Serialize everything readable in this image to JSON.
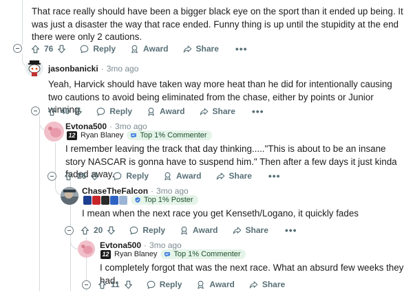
{
  "comments": [
    {
      "body": "That race really should have been a bigger black eye on the sport than it ended up being. It was just a disaster the way that race ended. Funny thing is up until the stupidity at the end there were only 2 cautions.",
      "votes": "76",
      "reply": "Reply",
      "award": "Award",
      "share": "Share",
      "more": "•••"
    },
    {
      "author": "jasonbanicki",
      "age": "3mo ago",
      "body": "Yeah, Harvick should have taken way more heat than he did for intentionally causing two cautions to avoid being eliminated from the chase, either by points or Junior winning.",
      "votes": "40",
      "reply": "Reply",
      "award": "Award",
      "share": "Share",
      "more": "•••"
    },
    {
      "author": "Evtona500",
      "age": "3mo ago",
      "flair_num": "12",
      "flair_text": "Ryan Blaney",
      "badge": "Top 1% Commenter",
      "body": "I remember leaving the track that day thinking.....\"This is about to be an insane story NASCAR is gonna have to suspend him.\" Then after a few days it just kinda faded away.",
      "votes": "26",
      "reply": "Reply",
      "award": "Award",
      "share": "Share",
      "more": "•••"
    },
    {
      "author": "ChaseTheFalcon",
      "age": "3mo ago",
      "badge": "Top 1% Poster",
      "body": "I mean when the next race you get Kenseth/Logano, it quickly fades",
      "votes": "20",
      "reply": "Reply",
      "award": "Award",
      "share": "Share",
      "more": "•••"
    },
    {
      "author": "Evtona500",
      "age": "3mo ago",
      "flair_num": "12",
      "flair_text": "Ryan Blaney",
      "badge": "Top 1% Commenter",
      "body": "I completely forgot that was the next race. What an absurd few weeks they had.",
      "votes": "11",
      "reply": "Reply",
      "award": "Award",
      "share": "Share"
    }
  ],
  "colors": {
    "action": "#576f76",
    "badge_bg": "#e5f4e9",
    "line": "#d6dadc"
  }
}
